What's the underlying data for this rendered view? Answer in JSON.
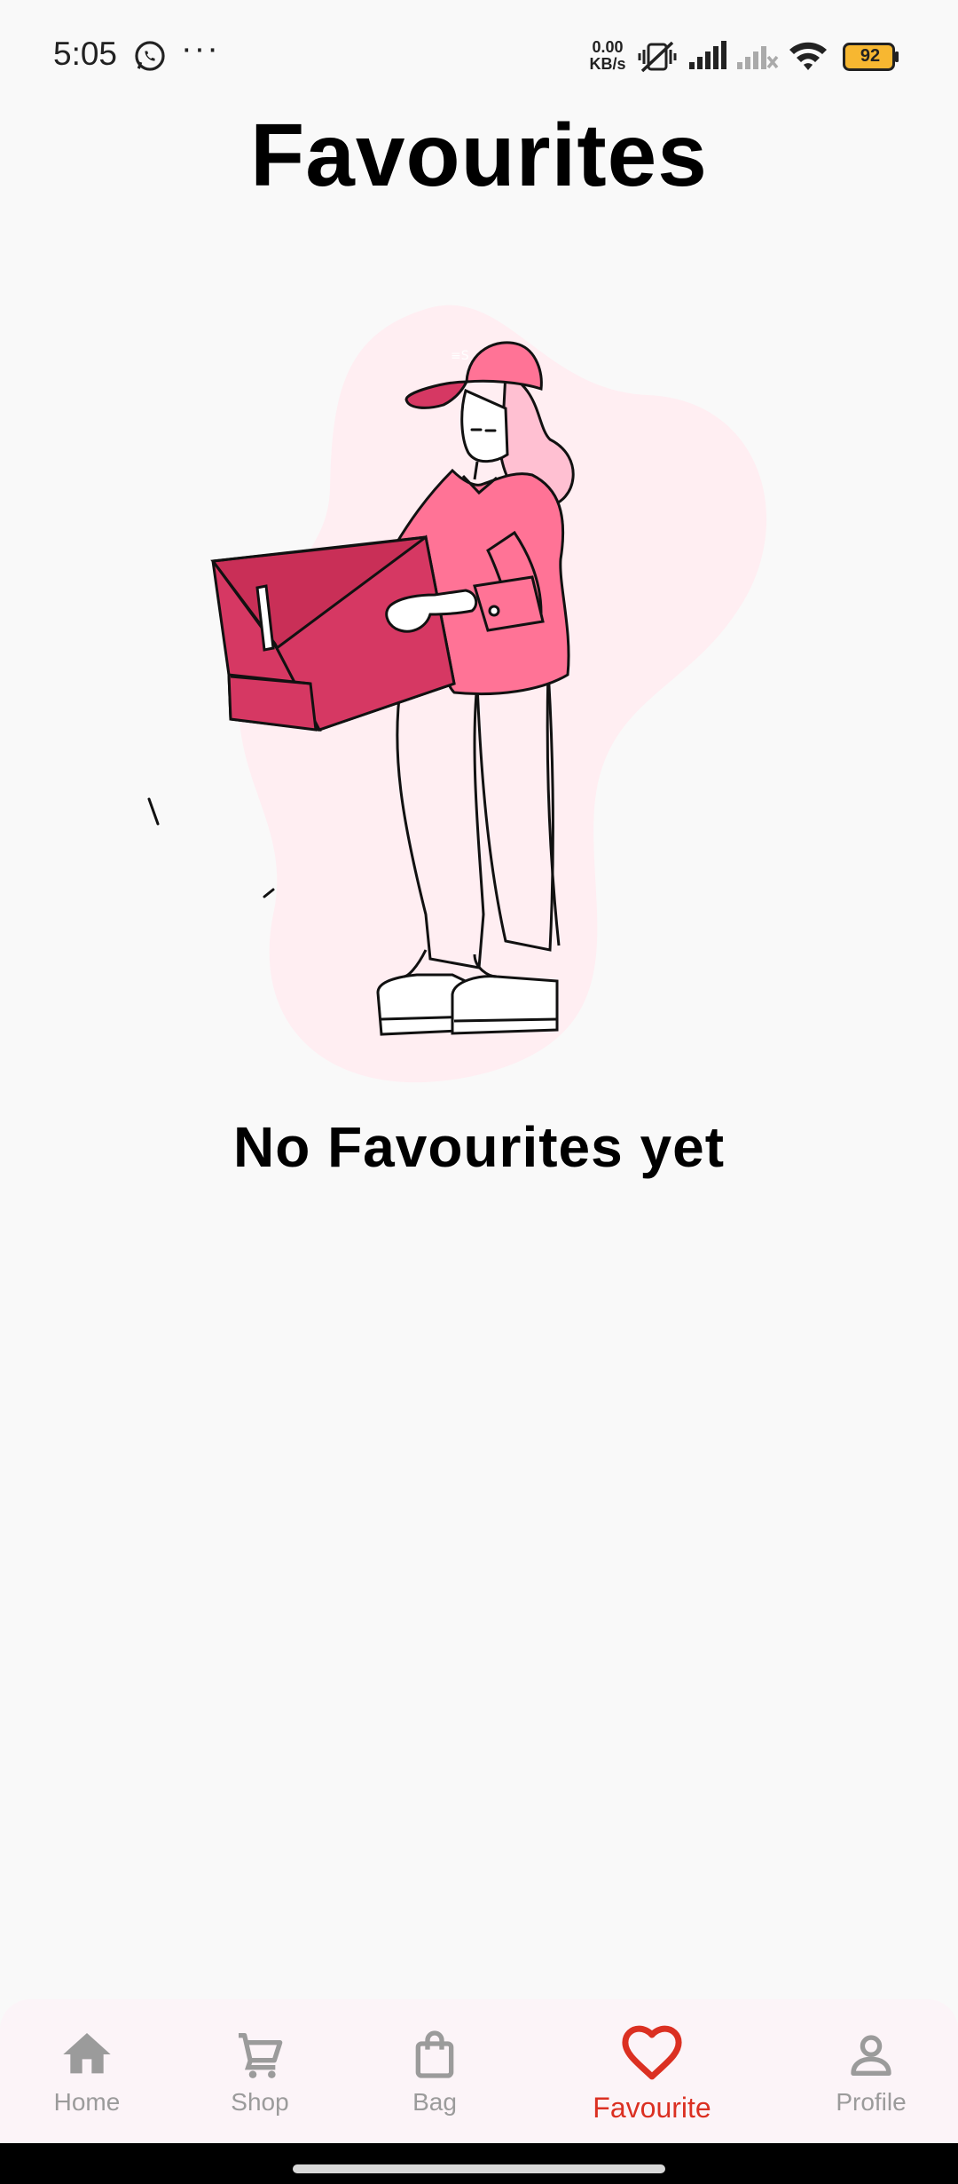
{
  "status_bar": {
    "time": "5:05",
    "more": "···",
    "net_speed_value": "0.00",
    "net_speed_unit": "KB/s",
    "battery": "92",
    "icons": [
      "whatsapp-icon",
      "more-icon",
      "mute-vibrate-icon",
      "signal-icon",
      "signal-off-icon",
      "wifi-icon",
      "battery-icon"
    ]
  },
  "page": {
    "title": "Favourites",
    "empty_message": "No Favourites yet"
  },
  "nav": {
    "items": [
      {
        "label": "Home",
        "icon": "home-icon",
        "active": false
      },
      {
        "label": "Shop",
        "icon": "cart-icon",
        "active": false
      },
      {
        "label": "Bag",
        "icon": "bag-icon",
        "active": false
      },
      {
        "label": "Favourite",
        "icon": "heart-icon",
        "active": true
      },
      {
        "label": "Profile",
        "icon": "profile-icon",
        "active": false
      }
    ]
  },
  "colors": {
    "accent": "#db3022",
    "inactive": "#9b9b9b",
    "background": "#f9f9f9",
    "nav_background": "#fcf4f8",
    "illustration_pink": "#ff7396",
    "illustration_box": "#d63863",
    "illustration_blob": "#ffeef2"
  }
}
